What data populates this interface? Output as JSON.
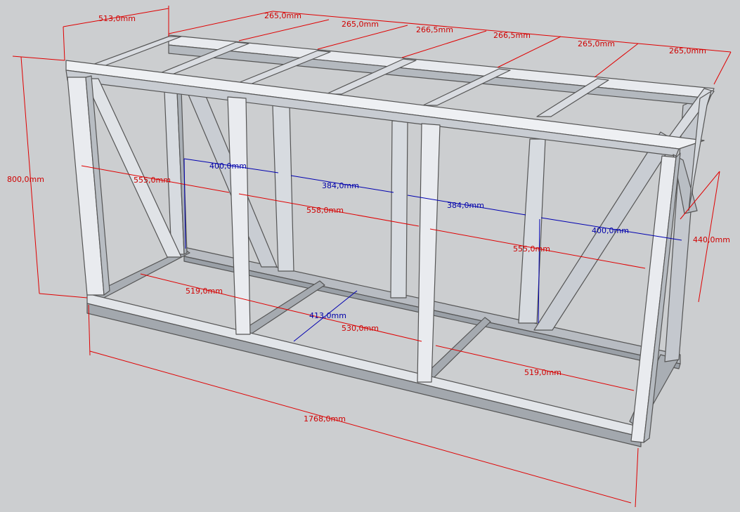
{
  "background_color": "#ccced0",
  "colors": {
    "dimension_red": "#d00000",
    "dimension_blue": "#0000aa",
    "beam_light": "#e4e6ea",
    "beam_mid": "#c4c8ce",
    "beam_dark": "#8f959c",
    "edge": "#555555"
  },
  "dimensions": {
    "width_top": "513,0mm",
    "top_spacing_1": "265,0mm",
    "top_spacing_2": "265,0mm",
    "top_spacing_3": "266,5mm",
    "top_spacing_4": "266,5mm",
    "top_spacing_5": "265,0mm",
    "top_spacing_6": "265,0mm",
    "height": "800,0mm",
    "back_gap_left": "400,0mm",
    "back_gap_mid_1": "384,0mm",
    "back_gap_mid_2": "384,0mm",
    "back_gap_right": "400,0mm",
    "front_span_left": "555,0mm",
    "front_span_mid": "558,0mm",
    "front_span_right": "555,0mm",
    "bottom_span_left": "519,0mm",
    "bottom_span_mid": "530,0mm",
    "bottom_span_right": "519,0mm",
    "bottom_depth": "413,0mm",
    "right_side": "440,0mm",
    "total_length": "1768,0mm"
  }
}
